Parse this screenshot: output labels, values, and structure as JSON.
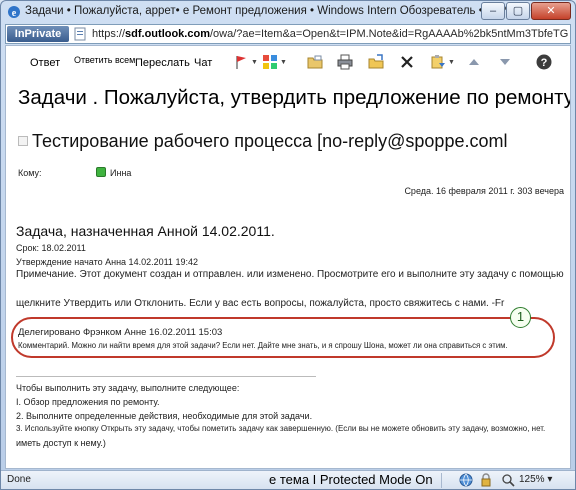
{
  "window": {
    "title": "Задачи • Пожалуйста, аррет• е Ремонт предложения • Windows Intern Обозреватель • gnPivatel",
    "minimize": "–",
    "maximize": "▢",
    "close": "✕"
  },
  "address": {
    "inprivate": "InPrivate",
    "url_prefix": "https://",
    "url_host": "sdf.outlook.com",
    "url_rest": "/owa/?ae=Item&a=Open&t=IPM.Note&id=RgAAAAb%2bk5ntMm3TbfeTGKj6KZRBwDFtt1AV"
  },
  "toolbar": {
    "reply": "Ответ",
    "reply_all": "Ответить всем",
    "forward": "Переслать",
    "chat": "Чат"
  },
  "message": {
    "subject": "Задачи . Пожалуйста, утвердить предложение по ремонту",
    "sender": "Тестирование рабочего процесса [no-reply@spoppe.coml",
    "to_label": "Кому:",
    "to_name": "Инна",
    "date": "Среда. 16 февраля 2011 г. 303 вечера",
    "task_heading": "Задача, назначенная Анной 14.02.2011.",
    "due": "Срок: 18.02.2011",
    "approval_started": "Утверждение начато Анна 14.02.2011 19:42",
    "note_line1": "Примечание. Этот документ создан и отправлен. или изменено. Просмотрите его и выполните эту задачу с помощью",
    "note_line2": "щелкните Утвердить или Отклонить. Если у вас есть вопросы, пожалуйста, просто свяжитесь с нами. -Fr",
    "delegated": "Делегировано Фрэнком Анне 16.02.2011 15:03",
    "comment": "Комментарий. Можно ли найти время для этой задачи? Если нет. Дайте мне знать, и я спрошу Шона, может ли она справиться с этим.",
    "callout_number": "1",
    "steps_intro": "Чтобы выполнить эту задачу, выполните следующее:",
    "step1": "I. Обзор предложения по ремонту.",
    "step2": "2. Выполните определенные действия, необходимые для этой задачи.",
    "step3": "3. Используйте кнопку Открыть эту задачу, чтобы пометить задачу как завершенную. (Если вы не можете обновить эту задачу, возможно, нет.",
    "step3_cont": "иметь доступ к нему.)"
  },
  "status": {
    "done": "Done",
    "zone": "е тема I Protected Mode On",
    "zoom": "125%",
    "arrow": "▾"
  }
}
